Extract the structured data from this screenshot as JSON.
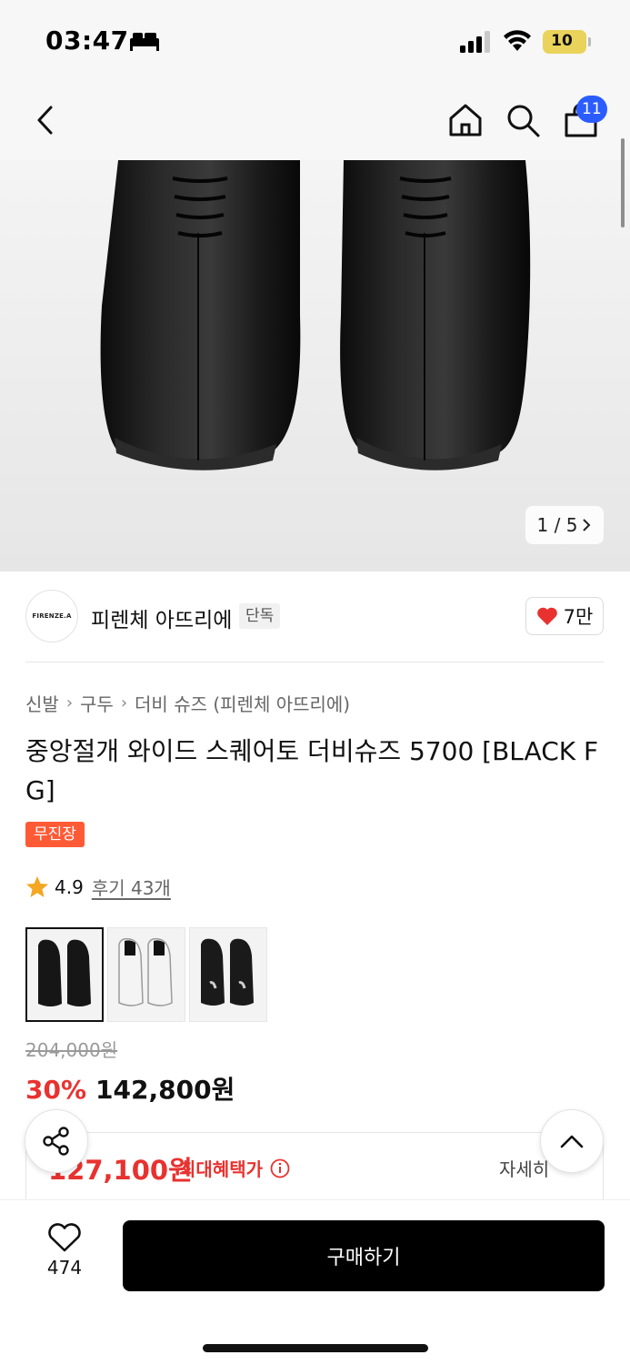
{
  "status_bar": {
    "time": "03:47",
    "battery": "10"
  },
  "header": {
    "cart_count": "11"
  },
  "gallery": {
    "counter": "1 / 5"
  },
  "brand": {
    "logo_text": "FIRENZE.A",
    "name": "피렌체 아뜨리에",
    "tag": "단독",
    "likes": "7만"
  },
  "breadcrumb": [
    "신발",
    "구두",
    "더비 슈즈 (피렌체 아뜨리에)"
  ],
  "product": {
    "title": "중앙절개 와이드 스퀘어토 더비슈즈 5700 [BLACK FG]",
    "shipping_badge": "무진장",
    "rating": "4.9",
    "reviews": "후기 43개",
    "variants": [
      {
        "name": "black",
        "selected": true
      },
      {
        "name": "white",
        "selected": false
      },
      {
        "name": "black-fg",
        "selected": false
      }
    ],
    "original_price": "204,000원",
    "discount": "30%",
    "sale_price": "142,800원"
  },
  "benefit": {
    "price": "127,100원",
    "label": "최대혜택가",
    "detail": "자세히"
  },
  "bottom_bar": {
    "wish_count": "474",
    "buy_label": "구매하기"
  },
  "colors": {
    "accent_red": "#e8322f",
    "badge_orange": "#ff5a36",
    "cart_badge_blue": "#2b5cff",
    "buy_button": "#000000"
  }
}
